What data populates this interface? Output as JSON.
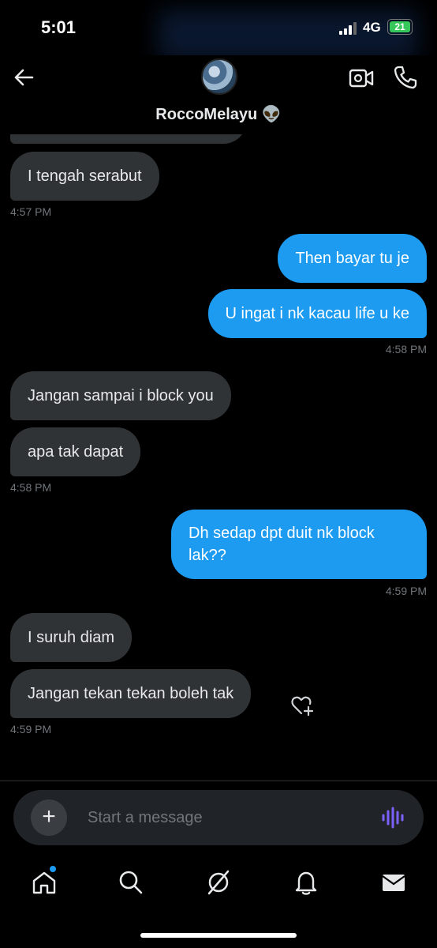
{
  "status": {
    "time": "5:01",
    "network": "4G",
    "battery": "21"
  },
  "header": {
    "contact_name": "RoccoMelayu 👽",
    "icons": [
      "back-arrow-icon",
      "video-camera-icon",
      "phone-icon"
    ]
  },
  "messages": [
    {
      "direction": "incoming",
      "text": "I tengah serabut"
    },
    {
      "direction": "outgoing",
      "text": "Then bayar tu je"
    },
    {
      "direction": "outgoing",
      "text": "U ingat i nk kacau life u ke"
    },
    {
      "direction": "incoming",
      "text": "Jangan sampai i block you"
    },
    {
      "direction": "incoming",
      "text": "apa tak dapat"
    },
    {
      "direction": "outgoing",
      "text": "Dh sedap dpt duit nk block lak??"
    },
    {
      "direction": "incoming",
      "text": "I suruh diam"
    },
    {
      "direction": "incoming",
      "text": "Jangan tekan tekan boleh tak"
    }
  ],
  "timestamps": [
    "4:57 PM",
    "4:58 PM",
    "4:58 PM",
    "4:59 PM",
    "4:59 PM"
  ],
  "composer": {
    "placeholder": "Start a message",
    "plus_label": "+"
  },
  "nav": {
    "items": [
      "home-icon",
      "search-icon",
      "grok-icon",
      "notifications-icon",
      "messages-icon"
    ]
  },
  "colors": {
    "accent": "#1d9bf0",
    "incoming_bubble": "#2f3336",
    "background": "#000000",
    "voice_icon": "#7b61ff"
  }
}
